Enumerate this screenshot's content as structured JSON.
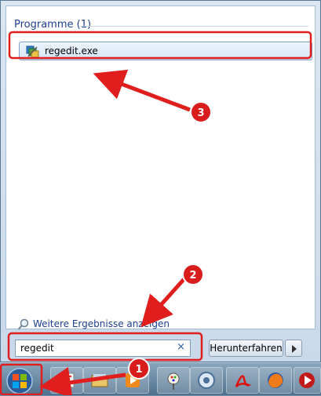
{
  "search_results": {
    "group_header": "Programme (1)",
    "items": [
      {
        "label": "regedit.exe",
        "icon": "regedit-icon"
      }
    ],
    "more_results_link": "Weitere Ergebnisse anzeigen"
  },
  "search": {
    "value": "regedit",
    "clear_glyph": "×"
  },
  "shutdown": {
    "label": "Herunterfahren"
  },
  "taskbar": {
    "items": [
      "start-orb",
      "explorer-icon",
      "library-icon",
      "media-player-icon",
      "paint-icon",
      "itunes-icon",
      "acrobat-icon",
      "firefox-icon",
      "media-app-icon"
    ]
  },
  "annotations": {
    "badges": [
      "1",
      "2",
      "3"
    ],
    "color": "#e01e1e"
  }
}
